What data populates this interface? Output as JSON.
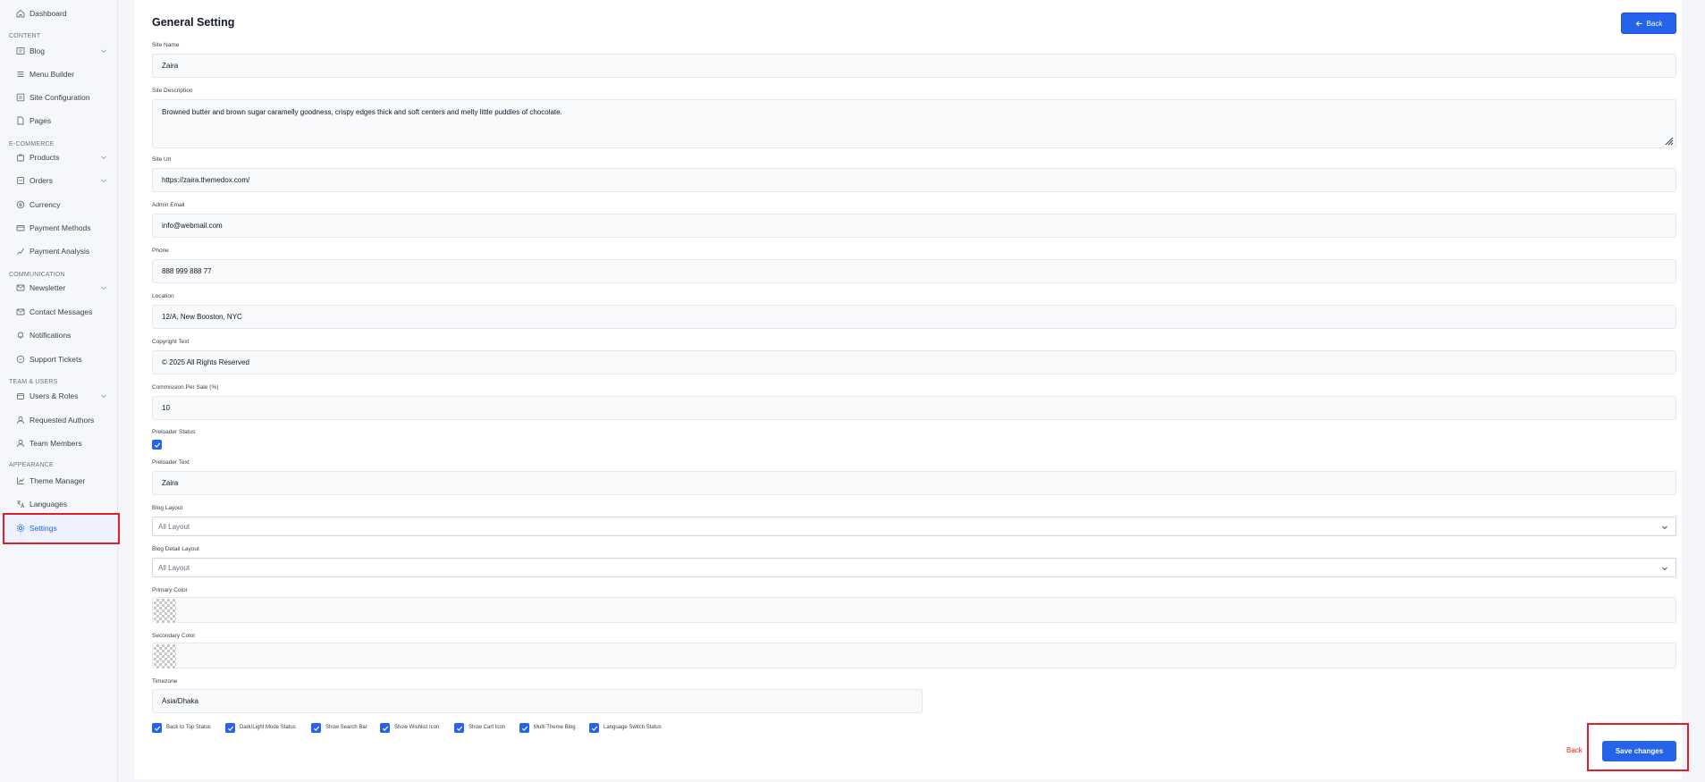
{
  "sidebar": {
    "sections": [
      "Content",
      "E-Commerce",
      "Communication",
      "Team & Users",
      "Appearance"
    ],
    "items": [
      {
        "label": "Dashboard"
      },
      {
        "label": "Blog"
      },
      {
        "label": "Menu Builder"
      },
      {
        "label": "Site Configuration"
      },
      {
        "label": "Pages"
      },
      {
        "label": "Products"
      },
      {
        "label": "Orders"
      },
      {
        "label": "Currency"
      },
      {
        "label": "Payment Methods"
      },
      {
        "label": "Payment Analysis"
      },
      {
        "label": "Newsletter"
      },
      {
        "label": "Contact Messages"
      },
      {
        "label": "Notifications"
      },
      {
        "label": "Support Tickets"
      },
      {
        "label": "Users & Roles"
      },
      {
        "label": "Requested Authors"
      },
      {
        "label": "Team Members"
      },
      {
        "label": "Theme Manager"
      },
      {
        "label": "Languages"
      },
      {
        "label": "Settings"
      }
    ]
  },
  "page": {
    "title": "General Setting",
    "back_label": "Back"
  },
  "form": {
    "site_name": {
      "label": "Site Name",
      "value": "Zaira"
    },
    "site_description": {
      "label": "Site Description",
      "value": "Browned butter and brown sugar caramelly goodness, crispy edges thick and soft centers and melty little puddles of chocolate."
    },
    "site_url": {
      "label": "Site Url",
      "value": "https://zaira.themedox.com/"
    },
    "admin_email": {
      "label": "Admin Email",
      "value": "info@webmail.com"
    },
    "phone": {
      "label": "Phone",
      "value": "888 999 888 77"
    },
    "location": {
      "label": "Location",
      "value": "12/A, New Booston, NYC"
    },
    "copyright": {
      "label": "Copyright Text",
      "value": "© 2025 All Rights Reserved"
    },
    "commission": {
      "label": "Commission Per Sale (%)",
      "value": "10"
    },
    "preloader_status": {
      "label": "Preloader Status",
      "checked": true
    },
    "preloader_text": {
      "label": "Preloader Text",
      "value": "Zaira"
    },
    "blog_layout": {
      "label": "Blog Layout",
      "value": "All Layout"
    },
    "blog_detail_layout": {
      "label": "Blog Detail Layout",
      "value": "All Layout"
    },
    "primary_color": {
      "label": "Primary Color"
    },
    "secondary_color": {
      "label": "Secondary Color"
    },
    "timezone": {
      "label": "Timezone",
      "value": "Asia/Dhaka"
    },
    "toggles": [
      {
        "label": "Back to Top Status",
        "checked": true
      },
      {
        "label": "Dark/Light Mode Status",
        "checked": true
      },
      {
        "label": "Show Search Bar",
        "checked": true
      },
      {
        "label": "Show Wishlist Icon",
        "checked": true
      },
      {
        "label": "Show Cart Icon",
        "checked": true
      },
      {
        "label": "Multi Theme Blog",
        "checked": true
      },
      {
        "label": "Language Switch Status",
        "checked": true
      }
    ]
  },
  "footer": {
    "back_label": "Back",
    "save_label": "Save changes"
  },
  "colors": {
    "accent": "#2563eb",
    "danger": "#dc2626",
    "highlight": "#e11d2b"
  }
}
